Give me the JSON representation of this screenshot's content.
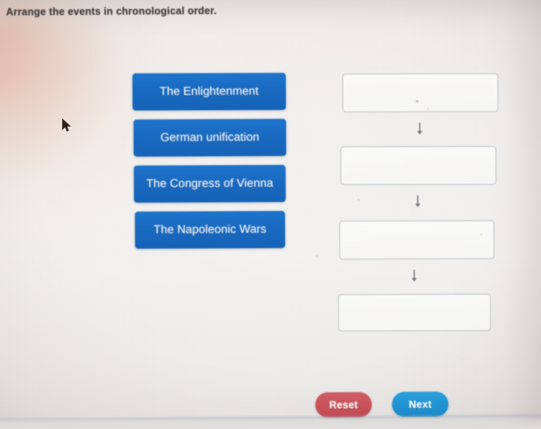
{
  "headline": "Arrange the events in chronological order.",
  "options": [
    {
      "label": "The Enlightenment"
    },
    {
      "label": "German unification"
    },
    {
      "label": "The Congress of Vienna"
    },
    {
      "label": "The Napoleonic Wars"
    }
  ],
  "slots": [
    {
      "value": "",
      "placeholder": ""
    },
    {
      "value": "",
      "placeholder": ""
    },
    {
      "value": "",
      "placeholder": ""
    },
    {
      "value": "",
      "placeholder": ""
    }
  ],
  "connectors": [
    {
      "icon": "arrow-down-icon"
    },
    {
      "icon": "arrow-down-icon"
    },
    {
      "icon": "arrow-down-icon"
    }
  ],
  "actions": {
    "reset_label": "Reset",
    "next_label": "Next"
  },
  "cursor": {
    "icon": "mouse-pointer-icon"
  },
  "colors": {
    "option_blue": "#1a6ac1",
    "reset_red": "#c85159",
    "next_blue": "#2092d2",
    "slot_border": "#b9c0c6",
    "headline_text": "#3f3d40",
    "page_background": "#f1efed"
  }
}
